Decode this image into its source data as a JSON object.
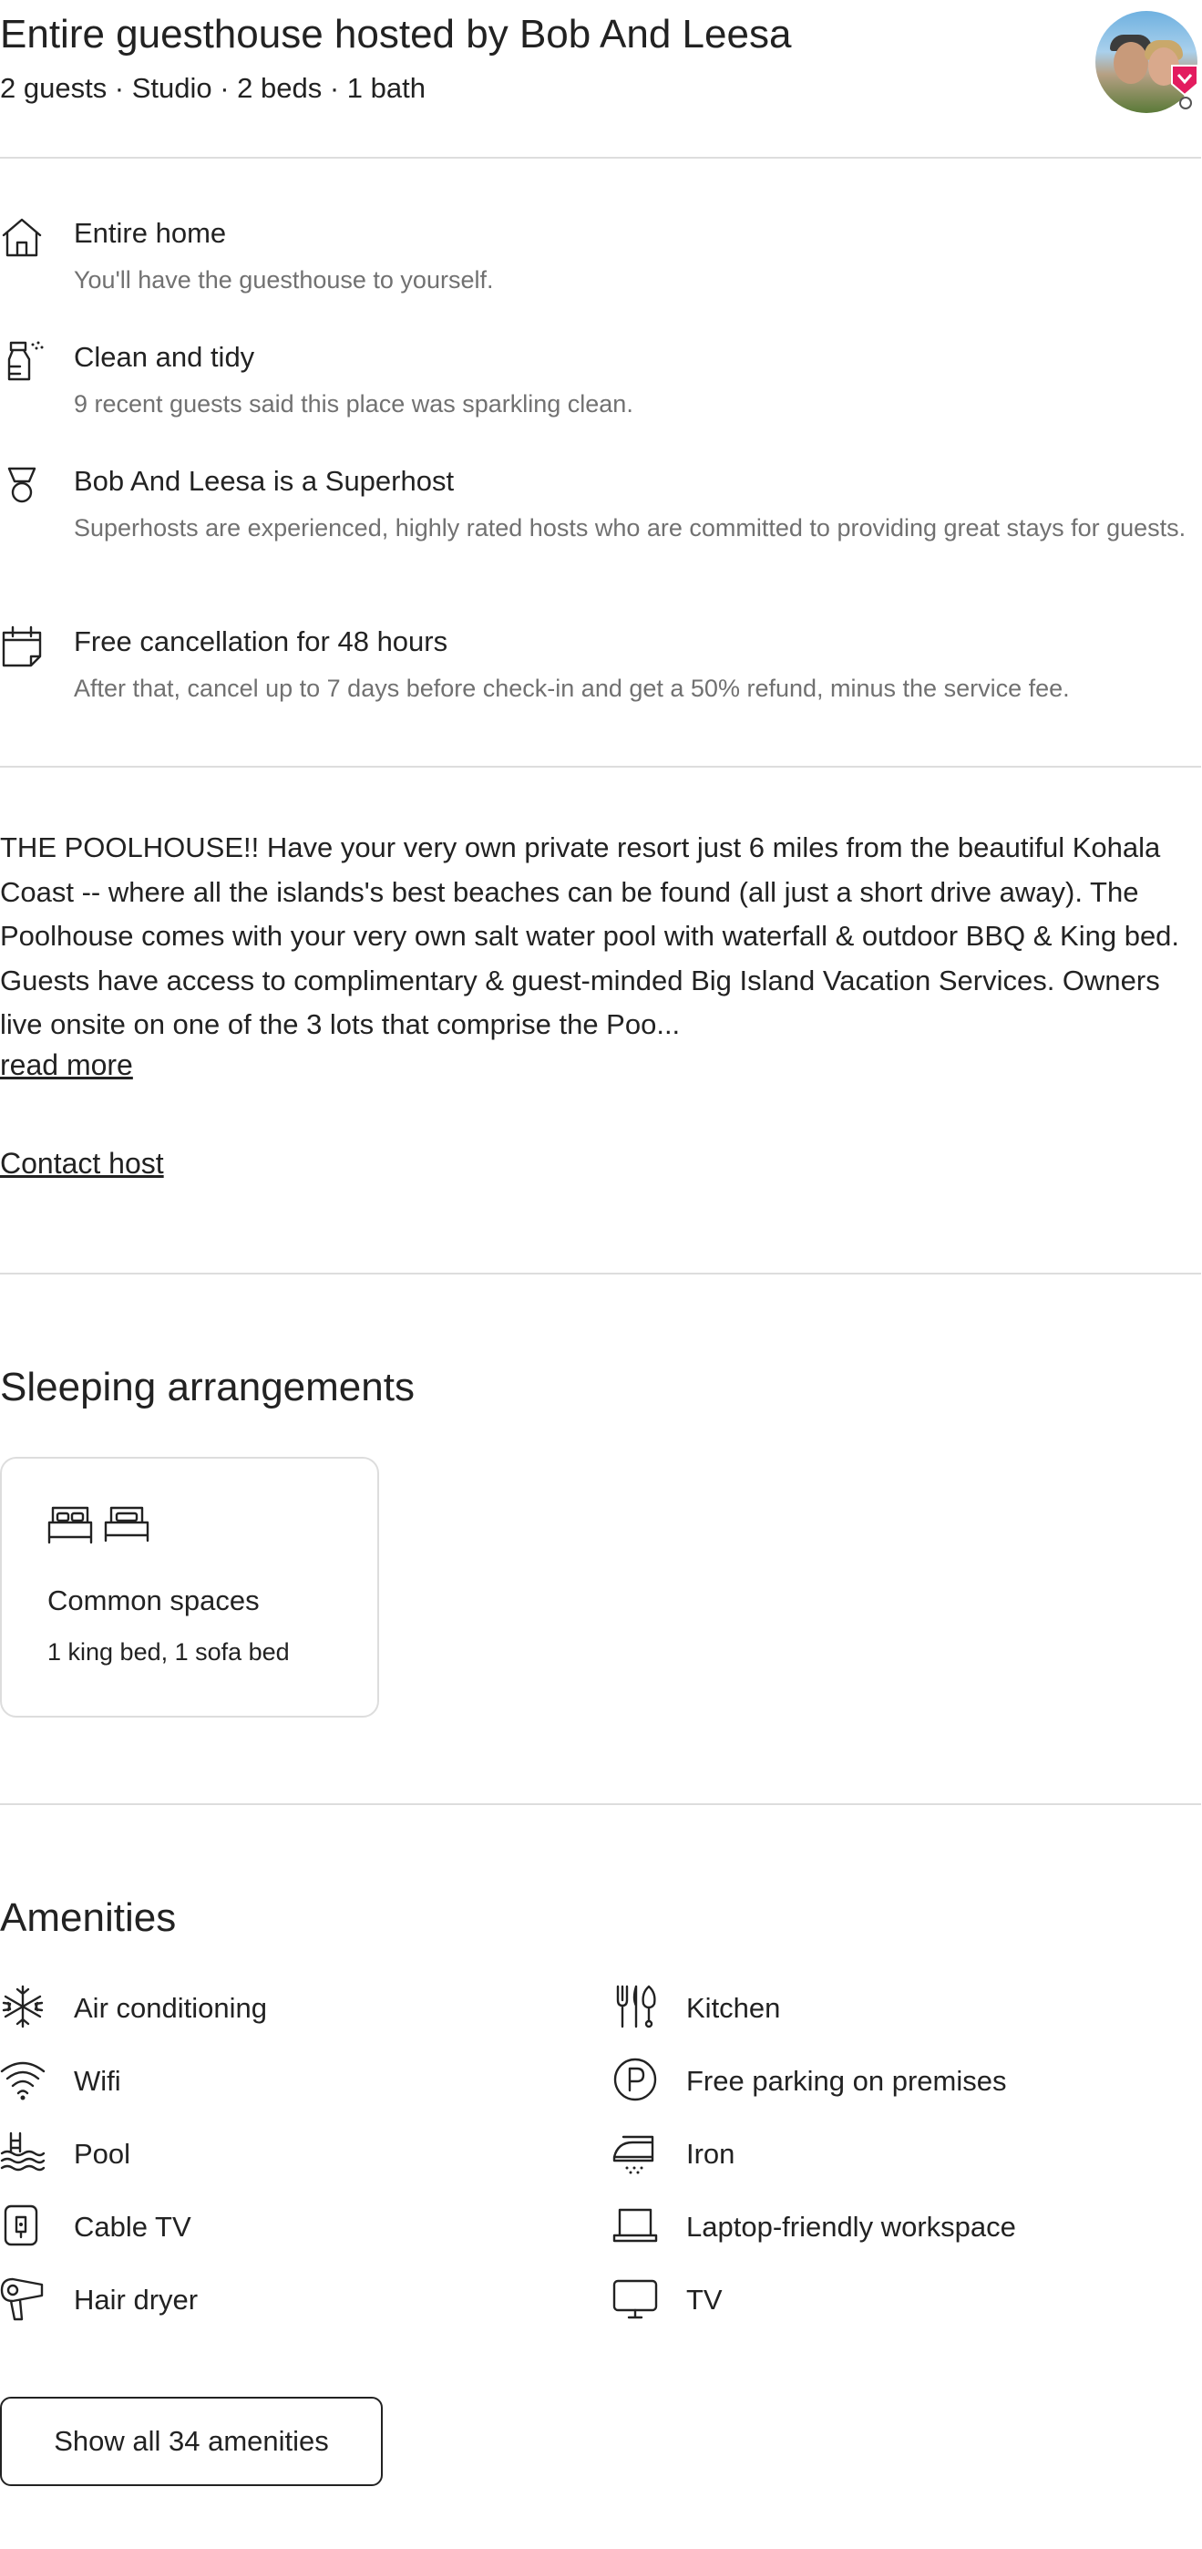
{
  "header": {
    "title": "Entire guesthouse hosted by Bob And Leesa",
    "subtitle": "2 guests · Studio · 2 beds · 1 bath"
  },
  "highlights": [
    {
      "icon": "home-icon",
      "title": "Entire home",
      "desc": "You'll have the guesthouse to yourself."
    },
    {
      "icon": "spray-bottle-icon",
      "title": "Clean and tidy",
      "desc": "9 recent guests said this place was sparkling clean."
    },
    {
      "icon": "medal-icon",
      "title": "Bob And Leesa is a Superhost",
      "desc": "Superhosts are experienced, highly rated hosts who are committed to providing great stays for guests."
    },
    {
      "icon": "calendar-icon",
      "title": "Free cancellation for 48 hours",
      "desc": "After that, cancel up to 7 days before check-in and get a 50% refund, minus the service fee."
    }
  ],
  "description": {
    "text": "THE POOLHOUSE!! Have your very own private resort just 6 miles from the beautiful Kohala Coast -- where all the islands's best beaches can be found (all just a short drive away). The Poolhouse comes with your very own salt water pool with waterfall & outdoor BBQ & King bed. Guests have access to complimentary & guest-minded Big Island Vacation Services. Owners live onsite on one of the 3 lots that comprise the Poo...",
    "read_more": "read more",
    "contact_host": "Contact host"
  },
  "sleeping": {
    "title": "Sleeping arrangements",
    "card": {
      "label": "Common spaces",
      "value": "1 king bed, 1 sofa bed"
    }
  },
  "amenities": {
    "title": "Amenities",
    "items": [
      {
        "icon": "snowflake-icon",
        "label": "Air conditioning"
      },
      {
        "icon": "kitchen-utensils-icon",
        "label": "Kitchen"
      },
      {
        "icon": "wifi-icon",
        "label": "Wifi"
      },
      {
        "icon": "parking-icon",
        "label": "Free parking on premises"
      },
      {
        "icon": "pool-icon",
        "label": "Pool"
      },
      {
        "icon": "iron-icon",
        "label": "Iron"
      },
      {
        "icon": "cable-tv-icon",
        "label": "Cable TV"
      },
      {
        "icon": "laptop-icon",
        "label": "Laptop-friendly workspace"
      },
      {
        "icon": "hair-dryer-icon",
        "label": "Hair dryer"
      },
      {
        "icon": "tv-icon",
        "label": "TV"
      }
    ],
    "show_all": "Show all 34 amenities"
  },
  "colors": {
    "text": "#222222",
    "muted": "#717171",
    "divider": "#dddddd",
    "superhost_badge": "#e31c5f"
  }
}
